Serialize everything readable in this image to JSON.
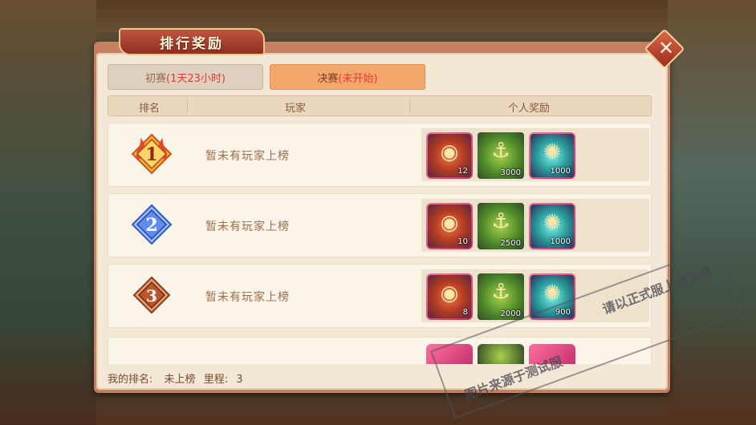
{
  "title": "排行奖励",
  "close_label": "✕",
  "tabs": [
    {
      "label": "初赛",
      "sub": "(1天23小时)",
      "active": false
    },
    {
      "label": "决赛",
      "sub": "(未开始)",
      "active": true
    }
  ],
  "columns": {
    "rank": "排名",
    "player": "玩家",
    "reward": "个人奖励"
  },
  "rows": [
    {
      "rank": "1",
      "player": "暂未有玩家上榜",
      "rewards": [
        {
          "icon": "shield-crest-icon",
          "qty": "12"
        },
        {
          "icon": "anchor-icon",
          "qty": "3000"
        },
        {
          "icon": "orb-icon",
          "qty": "1000"
        }
      ]
    },
    {
      "rank": "2",
      "player": "暂未有玩家上榜",
      "rewards": [
        {
          "icon": "shield-crest-icon",
          "qty": "10"
        },
        {
          "icon": "anchor-icon",
          "qty": "2500"
        },
        {
          "icon": "orb-icon",
          "qty": "1000"
        }
      ]
    },
    {
      "rank": "3",
      "player": "暂未有玩家上榜",
      "rewards": [
        {
          "icon": "shield-crest-icon",
          "qty": "8"
        },
        {
          "icon": "anchor-icon",
          "qty": "2000"
        },
        {
          "icon": "orb-icon",
          "qty": "900"
        }
      ]
    }
  ],
  "footer": {
    "my_rank_label": "我的排名:",
    "my_rank_value": "未上榜",
    "mileage_label": "里程:",
    "mileage_value": "3"
  },
  "watermark": {
    "line1": "图片来源于测试服",
    "line2": "请以正式服上线为准"
  },
  "colors": {
    "rank1": "#f08a2a",
    "rank2": "#4f7be8",
    "rank3": "#b8572e",
    "accent": "#e33d2a"
  }
}
